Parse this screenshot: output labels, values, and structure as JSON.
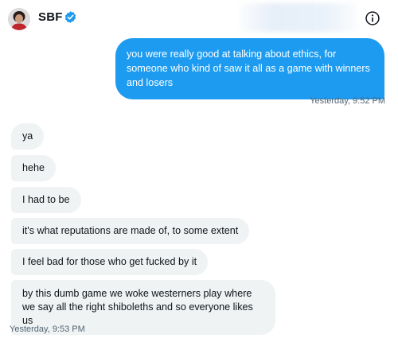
{
  "header": {
    "contact_name": "SBF",
    "verified_icon": "verified-badge-icon",
    "info_icon": "info-icon",
    "colors": {
      "verified": "#1d9bf0"
    }
  },
  "conversation": {
    "outgoing": [
      {
        "text": "you were really good at talking about ethics, for someone who kind of saw it all as a game with winners and losers"
      }
    ],
    "outgoing_timestamp": "Yesterday, 9:52 PM",
    "incoming": [
      {
        "text": "ya"
      },
      {
        "text": "hehe"
      },
      {
        "text": "I had to be"
      },
      {
        "text": "it's what reputations are made of, to some extent"
      },
      {
        "text": "I feel bad for those who get fucked by it"
      },
      {
        "text": "by this dumb game we woke westerners play where we say all the right shiboleths and so everyone likes us"
      }
    ],
    "incoming_timestamp": "Yesterday, 9:53 PM"
  },
  "colors": {
    "outgoing_bubble": "#1d9bf0",
    "incoming_bubble": "#eff3f4",
    "timestamp": "#536471"
  }
}
